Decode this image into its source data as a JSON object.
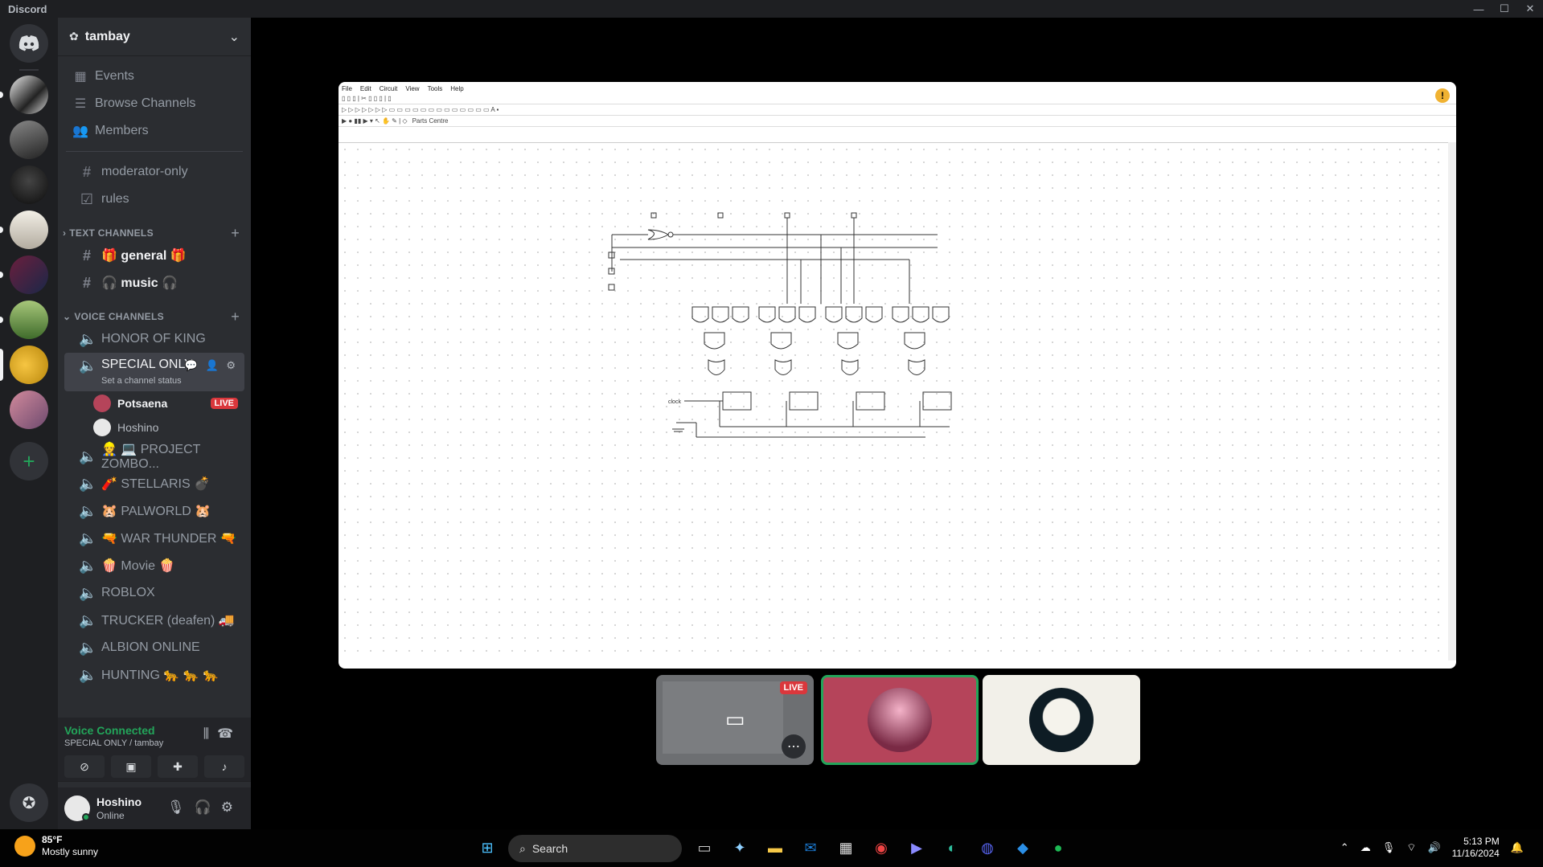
{
  "window": {
    "title": "Discord"
  },
  "guild": {
    "name": "tambay"
  },
  "nav": {
    "events": "Events",
    "browse": "Browse Channels",
    "members": "Members"
  },
  "top_channels": {
    "moderator": "moderator-only",
    "rules": "rules"
  },
  "text_category": "TEXT CHANNELS",
  "text_channels": [
    {
      "label": "🎁 general 🎁"
    },
    {
      "label": "🎧 music 🎧"
    }
  ],
  "voice_category": "VOICE CHANNELS",
  "voice_channels": {
    "honor": "HONOR OF KING",
    "special": "SPECIAL ONLY",
    "special_status": "Set a channel status",
    "users": [
      {
        "name": "Potsaena",
        "badge": "LIVE"
      },
      {
        "name": "Hoshino"
      }
    ],
    "rest": [
      "👷 💻 PROJECT ZOMBO...",
      "🧨 STELLARIS 💣",
      "🐹 PALWORLD 🐹",
      "🔫 WAR THUNDER 🔫",
      "🍿 Movie 🍿",
      "ROBLOX",
      "TRUCKER (deafen) 🚚",
      "ALBION ONLINE",
      "HUNTING 🐆 🐆 🐆"
    ]
  },
  "voice_panel": {
    "status": "Voice Connected",
    "channel": "SPECIAL ONLY / tambay"
  },
  "user_panel": {
    "name": "Hoshino",
    "status": "Online"
  },
  "stream": {
    "app_menu": [
      "File",
      "Edit",
      "Circuit",
      "View",
      "Tools",
      "Help"
    ],
    "parts_centre": "Parts Centre",
    "clock_label": "clock",
    "live_badge": "LIVE"
  },
  "taskbar": {
    "temp": "85°F",
    "weather": "Mostly sunny",
    "search": "Search",
    "time": "5:13 PM",
    "date": "11/16/2024"
  },
  "colors": {
    "accent_green": "#23a55a",
    "live_red": "#da373c",
    "sidebar": "#2b2d31",
    "servers": "#1e1f22"
  }
}
